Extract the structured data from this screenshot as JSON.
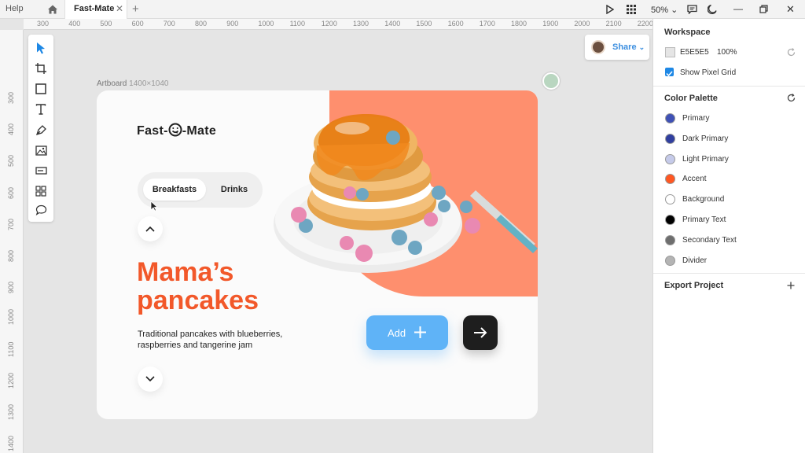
{
  "titlebar": {
    "help": "Help",
    "tab_title": "Fast-Mate",
    "tab_close": "✕",
    "new_tab": "+",
    "zoom": "50%"
  },
  "rulers": {
    "top": [
      "300",
      "400",
      "500",
      "600",
      "700",
      "800",
      "900",
      "1000",
      "1100",
      "1200",
      "1300",
      "1400",
      "1500",
      "1600",
      "1700",
      "1800",
      "1900",
      "2000",
      "2100",
      "2200"
    ],
    "left": [
      "300",
      "400",
      "500",
      "600",
      "700",
      "800",
      "900",
      "1000",
      "1100",
      "1200",
      "1300",
      "1400"
    ]
  },
  "canvas": {
    "artboard_label": "Artboard",
    "artboard_size": "1400×1040",
    "share": "Share"
  },
  "artboard": {
    "logo_left": "Fast-",
    "logo_right": "-Mate",
    "tabs": [
      "Breakfasts",
      "Drinks"
    ],
    "headline_1": "Mama’s",
    "headline_2": "pancakes",
    "description_1": "Traditional pancakes with blueberries,",
    "description_2": "raspberries and tangerine jam",
    "add_label": "Add"
  },
  "panel": {
    "workspace_title": "Workspace",
    "bg_hex": "E5E5E5",
    "bg_opacity": "100%",
    "pixel_grid_label": "Show Pixel Grid",
    "pixel_grid_checked": true,
    "palette_title": "Color Palette",
    "palette": [
      {
        "name": "Primary",
        "color": "#3f51b5"
      },
      {
        "name": "Dark Primary",
        "color": "#303f9f"
      },
      {
        "name": "Light Primary",
        "color": "#c5cae9"
      },
      {
        "name": "Accent",
        "color": "#ff5722"
      },
      {
        "name": "Background",
        "color": "#ffffff"
      },
      {
        "name": "Primary Text",
        "color": "#000000"
      },
      {
        "name": "Secondary Text",
        "color": "#6e6e6e"
      },
      {
        "name": "Divider",
        "color": "#b4b4b4"
      }
    ],
    "export_title": "Export Project"
  },
  "colors": {
    "accent": "#f2582a",
    "blob": "#fe8f6e",
    "add_button": "#5fb3f7",
    "share_text": "#3d8fe0"
  }
}
